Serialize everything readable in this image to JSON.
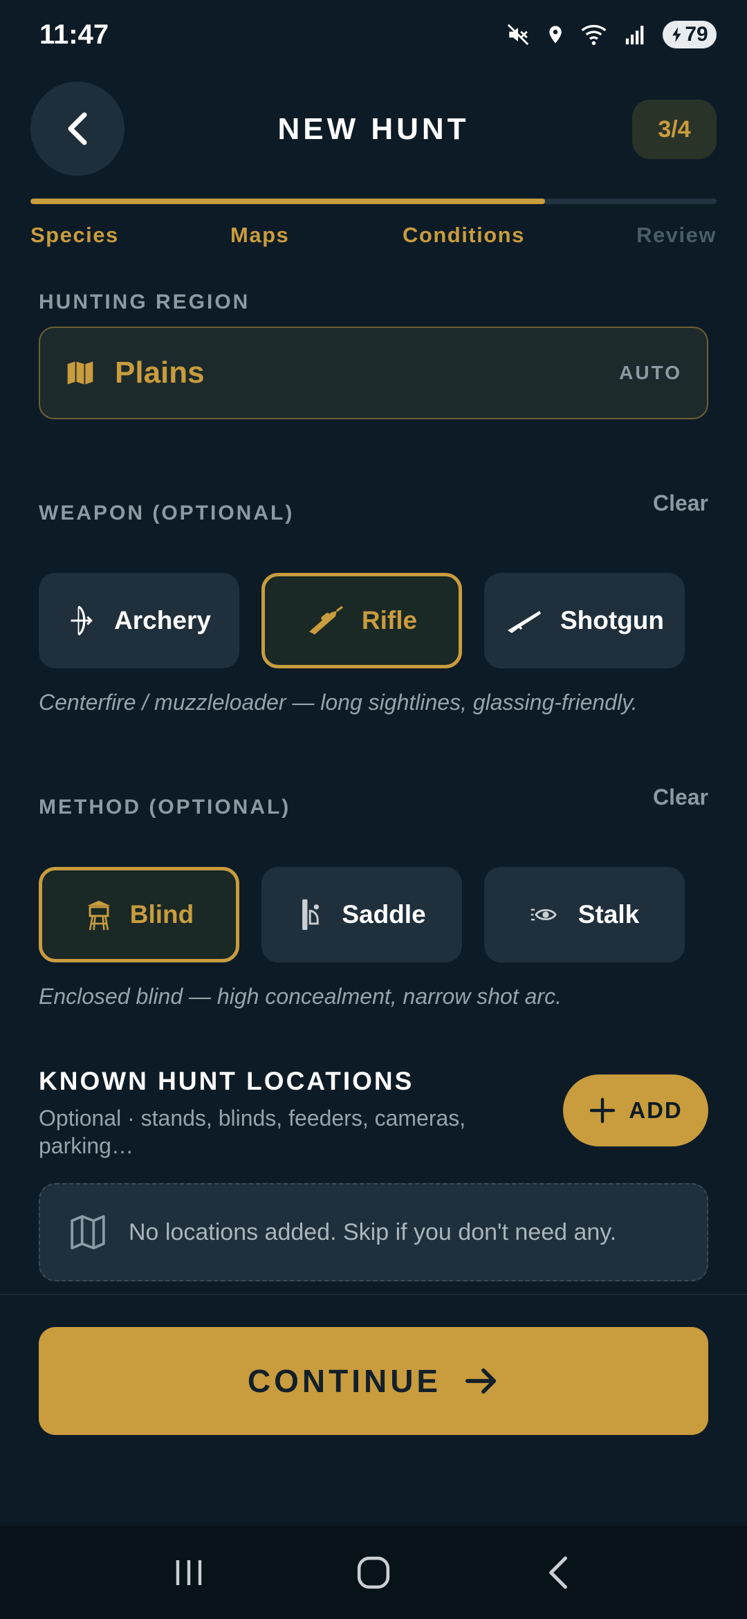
{
  "status": {
    "time": "11:47",
    "battery": "79",
    "icons": [
      "mute-icon",
      "location-icon",
      "wifi-icon",
      "signal-icon",
      "battery-icon"
    ]
  },
  "header": {
    "title": "NEW HUNT",
    "step_badge": "3/4"
  },
  "progress": {
    "fraction": 0.75
  },
  "steps": [
    {
      "label": "Species",
      "state": "done"
    },
    {
      "label": "Maps",
      "state": "done"
    },
    {
      "label": "Conditions",
      "state": "current"
    },
    {
      "label": "Review",
      "state": "upcoming"
    }
  ],
  "region": {
    "label": "HUNTING REGION",
    "value": "Plains",
    "badge": "AUTO",
    "icon": "map-icon"
  },
  "weapon": {
    "label": "WEAPON (OPTIONAL)",
    "clear_label": "Clear",
    "options": [
      {
        "label": "Archery",
        "icon": "bow-icon",
        "selected": false
      },
      {
        "label": "Rifle",
        "icon": "rifle-icon",
        "selected": true
      },
      {
        "label": "Shotgun",
        "icon": "shotgun-icon",
        "selected": false
      }
    ],
    "helper": "Centerfire / muzzleloader — long sightlines, glassing-friendly."
  },
  "method": {
    "label": "METHOD (OPTIONAL)",
    "clear_label": "Clear",
    "options": [
      {
        "label": "Blind",
        "icon": "blind-tower-icon",
        "selected": true
      },
      {
        "label": "Saddle",
        "icon": "saddle-icon",
        "selected": false
      },
      {
        "label": "Stalk",
        "icon": "stalk-eye-icon",
        "selected": false
      }
    ],
    "helper": "Enclosed blind — high concealment, narrow shot arc."
  },
  "known_locations": {
    "title": "KNOWN HUNT LOCATIONS",
    "subtitle": "Optional · stands, blinds, feeders, cameras, parking…",
    "add_label": "ADD",
    "empty_text": "No locations added. Skip if you don't need any."
  },
  "footer": {
    "continue_label": "CONTINUE"
  },
  "colors": {
    "background": "#0d1b26",
    "accent": "#c99c3e",
    "card": "#1f2f3b",
    "muted_text": "#8c9aa3"
  }
}
